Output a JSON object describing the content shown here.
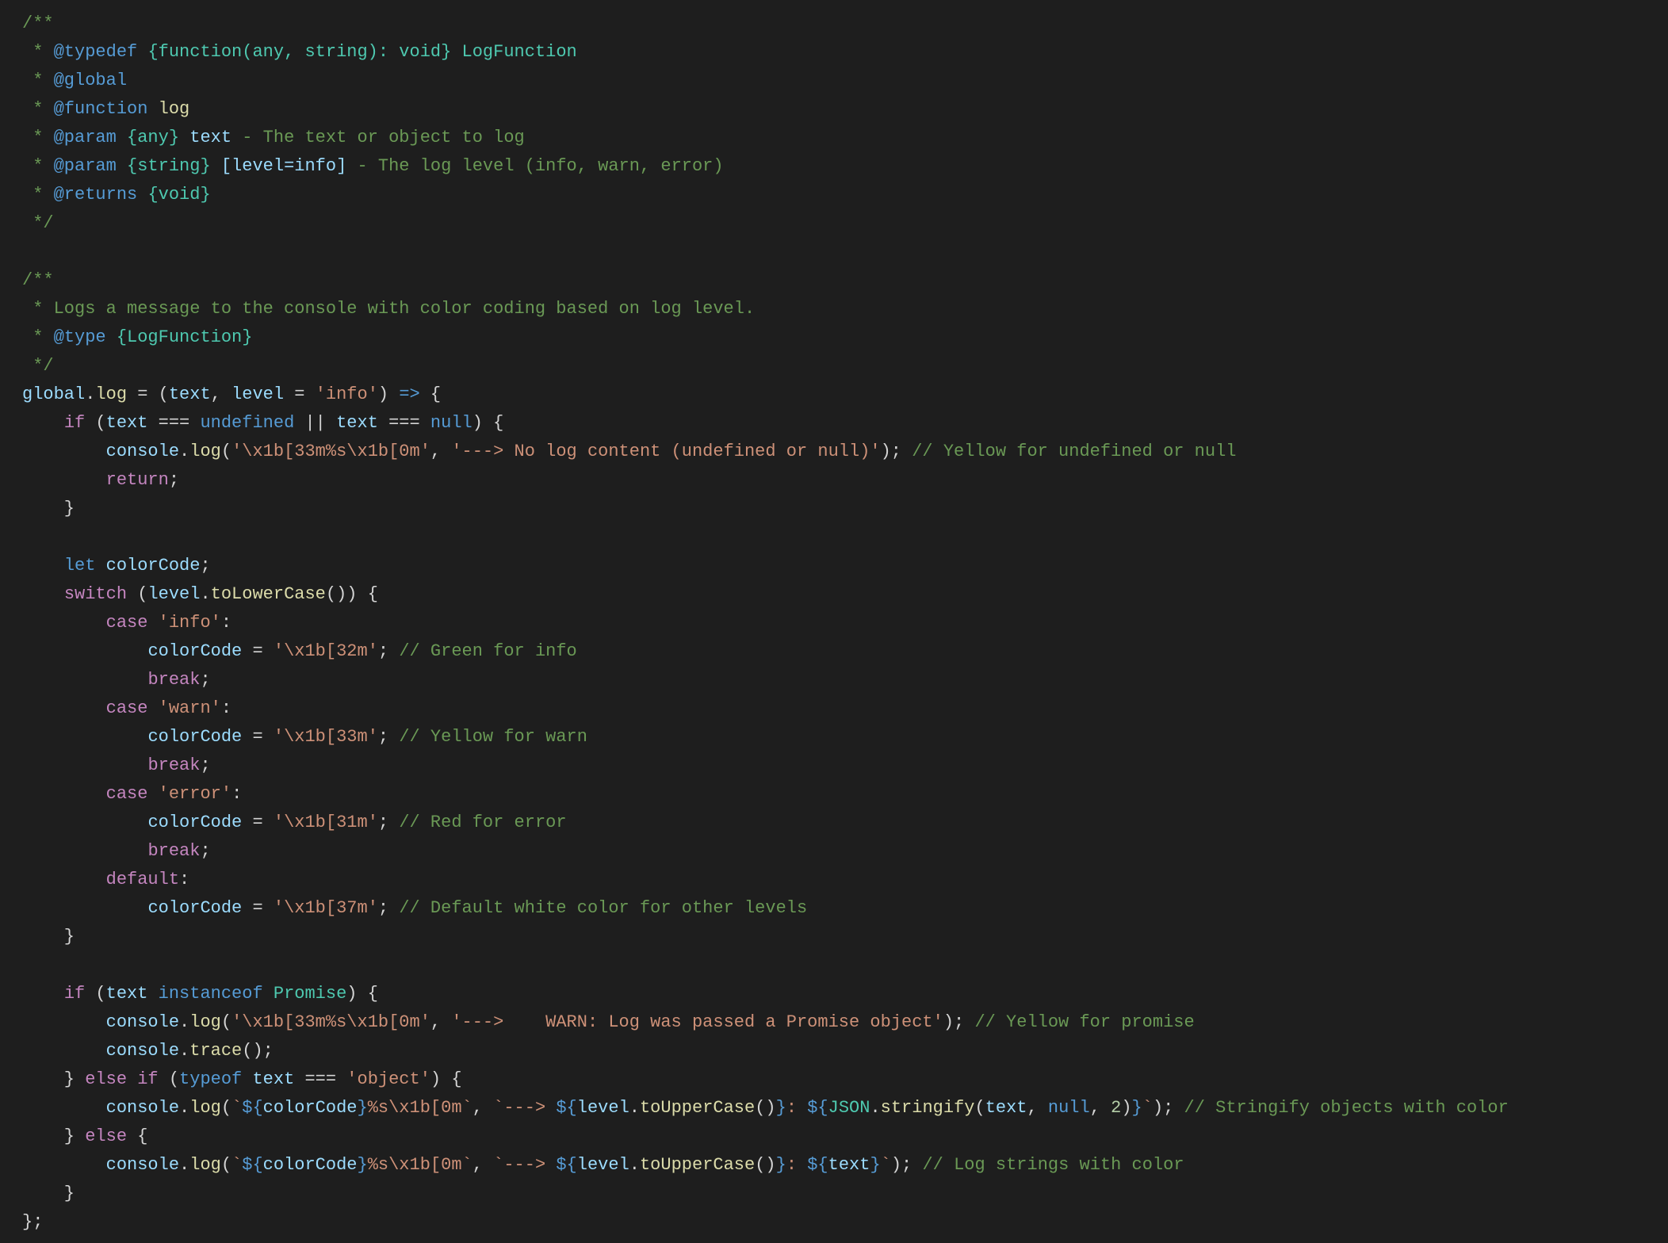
{
  "lines": [
    [
      {
        "t": "/**",
        "c": "jsdoc"
      }
    ],
    [
      {
        "t": " * ",
        "c": "jsdoc"
      },
      {
        "t": "@typedef",
        "c": "jstag"
      },
      {
        "t": " ",
        "c": "jsdoc"
      },
      {
        "t": "{function(any, string): void}",
        "c": "type"
      },
      {
        "t": " ",
        "c": "jsdoc"
      },
      {
        "t": "LogFunction",
        "c": "type"
      }
    ],
    [
      {
        "t": " * ",
        "c": "jsdoc"
      },
      {
        "t": "@global",
        "c": "jstag"
      }
    ],
    [
      {
        "t": " * ",
        "c": "jsdoc"
      },
      {
        "t": "@function",
        "c": "jstag"
      },
      {
        "t": " ",
        "c": "jsdoc"
      },
      {
        "t": "log",
        "c": "func"
      }
    ],
    [
      {
        "t": " * ",
        "c": "jsdoc"
      },
      {
        "t": "@param",
        "c": "jstag"
      },
      {
        "t": " ",
        "c": "jsdoc"
      },
      {
        "t": "{any}",
        "c": "type"
      },
      {
        "t": " ",
        "c": "jsdoc"
      },
      {
        "t": "text",
        "c": "ident"
      },
      {
        "t": " - The text or object to log",
        "c": "jsdoc"
      }
    ],
    [
      {
        "t": " * ",
        "c": "jsdoc"
      },
      {
        "t": "@param",
        "c": "jstag"
      },
      {
        "t": " ",
        "c": "jsdoc"
      },
      {
        "t": "{string}",
        "c": "type"
      },
      {
        "t": " ",
        "c": "jsdoc"
      },
      {
        "t": "[level=info]",
        "c": "ident"
      },
      {
        "t": " - The log level (info, warn, error)",
        "c": "jsdoc"
      }
    ],
    [
      {
        "t": " * ",
        "c": "jsdoc"
      },
      {
        "t": "@returns",
        "c": "jstag"
      },
      {
        "t": " ",
        "c": "jsdoc"
      },
      {
        "t": "{void}",
        "c": "type"
      }
    ],
    [
      {
        "t": " */",
        "c": "jsdoc"
      }
    ],
    [
      {
        "t": "",
        "c": "punc"
      }
    ],
    [
      {
        "t": "/**",
        "c": "jsdoc"
      }
    ],
    [
      {
        "t": " * Logs a message to the console with color coding based on log level.",
        "c": "jsdoc"
      }
    ],
    [
      {
        "t": " * ",
        "c": "jsdoc"
      },
      {
        "t": "@type",
        "c": "jstag"
      },
      {
        "t": " ",
        "c": "jsdoc"
      },
      {
        "t": "{LogFunction}",
        "c": "type"
      }
    ],
    [
      {
        "t": " */",
        "c": "jsdoc"
      }
    ],
    [
      {
        "t": "global",
        "c": "ident"
      },
      {
        "t": ".",
        "c": "punc"
      },
      {
        "t": "log",
        "c": "func"
      },
      {
        "t": " = (",
        "c": "punc"
      },
      {
        "t": "text",
        "c": "ident"
      },
      {
        "t": ", ",
        "c": "punc"
      },
      {
        "t": "level",
        "c": "ident"
      },
      {
        "t": " = ",
        "c": "punc"
      },
      {
        "t": "'info'",
        "c": "string"
      },
      {
        "t": ") ",
        "c": "punc"
      },
      {
        "t": "=>",
        "c": "keyword"
      },
      {
        "t": " {",
        "c": "punc"
      }
    ],
    [
      {
        "t": "    ",
        "c": "punc"
      },
      {
        "t": "if",
        "c": "ctrl"
      },
      {
        "t": " (",
        "c": "punc"
      },
      {
        "t": "text",
        "c": "ident"
      },
      {
        "t": " === ",
        "c": "op"
      },
      {
        "t": "undefined",
        "c": "const"
      },
      {
        "t": " || ",
        "c": "op"
      },
      {
        "t": "text",
        "c": "ident"
      },
      {
        "t": " === ",
        "c": "op"
      },
      {
        "t": "null",
        "c": "const"
      },
      {
        "t": ") {",
        "c": "punc"
      }
    ],
    [
      {
        "t": "        ",
        "c": "punc"
      },
      {
        "t": "console",
        "c": "ident"
      },
      {
        "t": ".",
        "c": "punc"
      },
      {
        "t": "log",
        "c": "func"
      },
      {
        "t": "(",
        "c": "punc"
      },
      {
        "t": "'\\x1b[33m%s\\x1b[0m'",
        "c": "string"
      },
      {
        "t": ", ",
        "c": "punc"
      },
      {
        "t": "'---> No log content (undefined or null)'",
        "c": "string"
      },
      {
        "t": "); ",
        "c": "punc"
      },
      {
        "t": "// Yellow for undefined or null",
        "c": "comment"
      }
    ],
    [
      {
        "t": "        ",
        "c": "punc"
      },
      {
        "t": "return",
        "c": "ctrl"
      },
      {
        "t": ";",
        "c": "punc"
      }
    ],
    [
      {
        "t": "    }",
        "c": "punc"
      }
    ],
    [
      {
        "t": "",
        "c": "punc"
      }
    ],
    [
      {
        "t": "    ",
        "c": "punc"
      },
      {
        "t": "let",
        "c": "keyword"
      },
      {
        "t": " ",
        "c": "punc"
      },
      {
        "t": "colorCode",
        "c": "ident"
      },
      {
        "t": ";",
        "c": "punc"
      }
    ],
    [
      {
        "t": "    ",
        "c": "punc"
      },
      {
        "t": "switch",
        "c": "ctrl"
      },
      {
        "t": " (",
        "c": "punc"
      },
      {
        "t": "level",
        "c": "ident"
      },
      {
        "t": ".",
        "c": "punc"
      },
      {
        "t": "toLowerCase",
        "c": "func"
      },
      {
        "t": "()) {",
        "c": "punc"
      }
    ],
    [
      {
        "t": "        ",
        "c": "punc"
      },
      {
        "t": "case",
        "c": "ctrl"
      },
      {
        "t": " ",
        "c": "punc"
      },
      {
        "t": "'info'",
        "c": "string"
      },
      {
        "t": ":",
        "c": "punc"
      }
    ],
    [
      {
        "t": "            ",
        "c": "punc"
      },
      {
        "t": "colorCode",
        "c": "ident"
      },
      {
        "t": " = ",
        "c": "op"
      },
      {
        "t": "'\\x1b[32m'",
        "c": "string"
      },
      {
        "t": "; ",
        "c": "punc"
      },
      {
        "t": "// Green for info",
        "c": "comment"
      }
    ],
    [
      {
        "t": "            ",
        "c": "punc"
      },
      {
        "t": "break",
        "c": "ctrl"
      },
      {
        "t": ";",
        "c": "punc"
      }
    ],
    [
      {
        "t": "        ",
        "c": "punc"
      },
      {
        "t": "case",
        "c": "ctrl"
      },
      {
        "t": " ",
        "c": "punc"
      },
      {
        "t": "'warn'",
        "c": "string"
      },
      {
        "t": ":",
        "c": "punc"
      }
    ],
    [
      {
        "t": "            ",
        "c": "punc"
      },
      {
        "t": "colorCode",
        "c": "ident"
      },
      {
        "t": " = ",
        "c": "op"
      },
      {
        "t": "'\\x1b[33m'",
        "c": "string"
      },
      {
        "t": "; ",
        "c": "punc"
      },
      {
        "t": "// Yellow for warn",
        "c": "comment"
      }
    ],
    [
      {
        "t": "            ",
        "c": "punc"
      },
      {
        "t": "break",
        "c": "ctrl"
      },
      {
        "t": ";",
        "c": "punc"
      }
    ],
    [
      {
        "t": "        ",
        "c": "punc"
      },
      {
        "t": "case",
        "c": "ctrl"
      },
      {
        "t": " ",
        "c": "punc"
      },
      {
        "t": "'error'",
        "c": "string"
      },
      {
        "t": ":",
        "c": "punc"
      }
    ],
    [
      {
        "t": "            ",
        "c": "punc"
      },
      {
        "t": "colorCode",
        "c": "ident"
      },
      {
        "t": " = ",
        "c": "op"
      },
      {
        "t": "'\\x1b[31m'",
        "c": "string"
      },
      {
        "t": "; ",
        "c": "punc"
      },
      {
        "t": "// Red for error",
        "c": "comment"
      }
    ],
    [
      {
        "t": "            ",
        "c": "punc"
      },
      {
        "t": "break",
        "c": "ctrl"
      },
      {
        "t": ";",
        "c": "punc"
      }
    ],
    [
      {
        "t": "        ",
        "c": "punc"
      },
      {
        "t": "default",
        "c": "ctrl"
      },
      {
        "t": ":",
        "c": "punc"
      }
    ],
    [
      {
        "t": "            ",
        "c": "punc"
      },
      {
        "t": "colorCode",
        "c": "ident"
      },
      {
        "t": " = ",
        "c": "op"
      },
      {
        "t": "'\\x1b[37m'",
        "c": "string"
      },
      {
        "t": "; ",
        "c": "punc"
      },
      {
        "t": "// Default white color for other levels",
        "c": "comment"
      }
    ],
    [
      {
        "t": "    }",
        "c": "punc"
      }
    ],
    [
      {
        "t": "",
        "c": "punc"
      }
    ],
    [
      {
        "t": "    ",
        "c": "punc"
      },
      {
        "t": "if",
        "c": "ctrl"
      },
      {
        "t": " (",
        "c": "punc"
      },
      {
        "t": "text",
        "c": "ident"
      },
      {
        "t": " ",
        "c": "punc"
      },
      {
        "t": "instanceof",
        "c": "keyword"
      },
      {
        "t": " ",
        "c": "punc"
      },
      {
        "t": "Promise",
        "c": "obj"
      },
      {
        "t": ") {",
        "c": "punc"
      }
    ],
    [
      {
        "t": "        ",
        "c": "punc"
      },
      {
        "t": "console",
        "c": "ident"
      },
      {
        "t": ".",
        "c": "punc"
      },
      {
        "t": "log",
        "c": "func"
      },
      {
        "t": "(",
        "c": "punc"
      },
      {
        "t": "'\\x1b[33m%s\\x1b[0m'",
        "c": "string"
      },
      {
        "t": ", ",
        "c": "punc"
      },
      {
        "t": "'--->    WARN: Log was passed a Promise object'",
        "c": "string"
      },
      {
        "t": "); ",
        "c": "punc"
      },
      {
        "t": "// Yellow for promise",
        "c": "comment"
      }
    ],
    [
      {
        "t": "        ",
        "c": "punc"
      },
      {
        "t": "console",
        "c": "ident"
      },
      {
        "t": ".",
        "c": "punc"
      },
      {
        "t": "trace",
        "c": "func"
      },
      {
        "t": "();",
        "c": "punc"
      }
    ],
    [
      {
        "t": "    } ",
        "c": "punc"
      },
      {
        "t": "else",
        "c": "ctrl"
      },
      {
        "t": " ",
        "c": "punc"
      },
      {
        "t": "if",
        "c": "ctrl"
      },
      {
        "t": " (",
        "c": "punc"
      },
      {
        "t": "typeof",
        "c": "keyword"
      },
      {
        "t": " ",
        "c": "punc"
      },
      {
        "t": "text",
        "c": "ident"
      },
      {
        "t": " === ",
        "c": "op"
      },
      {
        "t": "'object'",
        "c": "string"
      },
      {
        "t": ") {",
        "c": "punc"
      }
    ],
    [
      {
        "t": "        ",
        "c": "punc"
      },
      {
        "t": "console",
        "c": "ident"
      },
      {
        "t": ".",
        "c": "punc"
      },
      {
        "t": "log",
        "c": "func"
      },
      {
        "t": "(",
        "c": "punc"
      },
      {
        "t": "`",
        "c": "string"
      },
      {
        "t": "${",
        "c": "keyword"
      },
      {
        "t": "colorCode",
        "c": "ident"
      },
      {
        "t": "}",
        "c": "keyword"
      },
      {
        "t": "%s\\x1b[0m`",
        "c": "string"
      },
      {
        "t": ", ",
        "c": "punc"
      },
      {
        "t": "`---> ",
        "c": "string"
      },
      {
        "t": "${",
        "c": "keyword"
      },
      {
        "t": "level",
        "c": "ident"
      },
      {
        "t": ".",
        "c": "punc"
      },
      {
        "t": "toUpperCase",
        "c": "func"
      },
      {
        "t": "()",
        "c": "punc"
      },
      {
        "t": "}",
        "c": "keyword"
      },
      {
        "t": ": ",
        "c": "string"
      },
      {
        "t": "${",
        "c": "keyword"
      },
      {
        "t": "JSON",
        "c": "obj"
      },
      {
        "t": ".",
        "c": "punc"
      },
      {
        "t": "stringify",
        "c": "func"
      },
      {
        "t": "(",
        "c": "punc"
      },
      {
        "t": "text",
        "c": "ident"
      },
      {
        "t": ", ",
        "c": "punc"
      },
      {
        "t": "null",
        "c": "const"
      },
      {
        "t": ", ",
        "c": "punc"
      },
      {
        "t": "2",
        "c": "num"
      },
      {
        "t": ")",
        "c": "punc"
      },
      {
        "t": "}",
        "c": "keyword"
      },
      {
        "t": "`",
        "c": "string"
      },
      {
        "t": "); ",
        "c": "punc"
      },
      {
        "t": "// Stringify objects with color",
        "c": "comment"
      }
    ],
    [
      {
        "t": "    } ",
        "c": "punc"
      },
      {
        "t": "else",
        "c": "ctrl"
      },
      {
        "t": " {",
        "c": "punc"
      }
    ],
    [
      {
        "t": "        ",
        "c": "punc"
      },
      {
        "t": "console",
        "c": "ident"
      },
      {
        "t": ".",
        "c": "punc"
      },
      {
        "t": "log",
        "c": "func"
      },
      {
        "t": "(",
        "c": "punc"
      },
      {
        "t": "`",
        "c": "string"
      },
      {
        "t": "${",
        "c": "keyword"
      },
      {
        "t": "colorCode",
        "c": "ident"
      },
      {
        "t": "}",
        "c": "keyword"
      },
      {
        "t": "%s\\x1b[0m`",
        "c": "string"
      },
      {
        "t": ", ",
        "c": "punc"
      },
      {
        "t": "`---> ",
        "c": "string"
      },
      {
        "t": "${",
        "c": "keyword"
      },
      {
        "t": "level",
        "c": "ident"
      },
      {
        "t": ".",
        "c": "punc"
      },
      {
        "t": "toUpperCase",
        "c": "func"
      },
      {
        "t": "()",
        "c": "punc"
      },
      {
        "t": "}",
        "c": "keyword"
      },
      {
        "t": ": ",
        "c": "string"
      },
      {
        "t": "${",
        "c": "keyword"
      },
      {
        "t": "text",
        "c": "ident"
      },
      {
        "t": "}",
        "c": "keyword"
      },
      {
        "t": "`",
        "c": "string"
      },
      {
        "t": "); ",
        "c": "punc"
      },
      {
        "t": "// Log strings with color",
        "c": "comment"
      }
    ],
    [
      {
        "t": "    }",
        "c": "punc"
      }
    ],
    [
      {
        "t": "};",
        "c": "punc"
      }
    ]
  ],
  "classmap": {
    "comment": "c-comment",
    "jsdoc": "c-jsdoc",
    "jstag": "c-jstag",
    "type": "c-type",
    "keyword": "c-keyword",
    "ctrl": "c-ctrl",
    "ident": "c-ident",
    "func": "c-func",
    "string": "c-string",
    "const": "c-const",
    "num": "c-num",
    "punc": "c-punc",
    "op": "c-op",
    "prop": "c-prop",
    "obj": "c-obj"
  }
}
